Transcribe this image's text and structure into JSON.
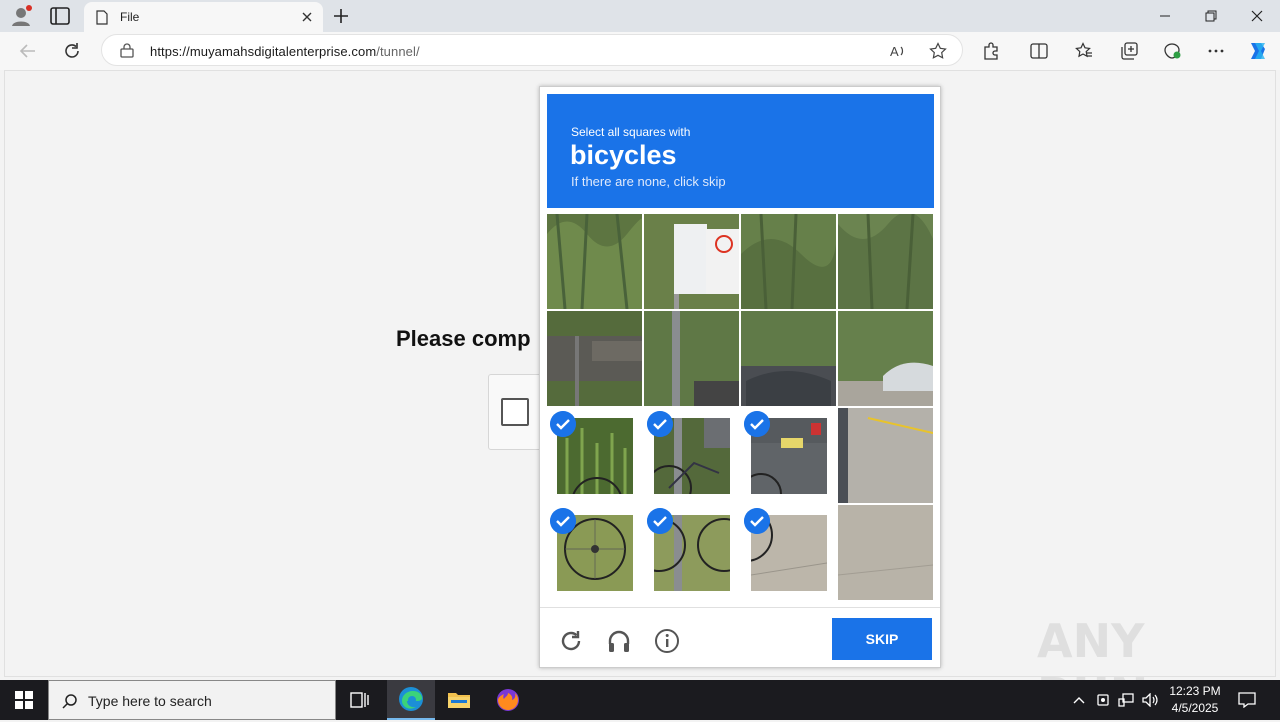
{
  "browser": {
    "tab_title": "File",
    "url_host": "https://muyamahsdigitalenterprise.com",
    "url_path": "/tunnel/"
  },
  "page": {
    "heading": "Please comp"
  },
  "captcha": {
    "instruction": "Select all squares with",
    "target": "bicycles",
    "hint": "If there are none, click skip",
    "skip_label": "SKIP",
    "tiles": [
      {
        "selected": false
      },
      {
        "selected": false
      },
      {
        "selected": false
      },
      {
        "selected": false
      },
      {
        "selected": false
      },
      {
        "selected": false
      },
      {
        "selected": false
      },
      {
        "selected": false
      },
      {
        "selected": true
      },
      {
        "selected": true
      },
      {
        "selected": true
      },
      {
        "selected": false
      },
      {
        "selected": true
      },
      {
        "selected": true
      },
      {
        "selected": true
      },
      {
        "selected": false
      }
    ]
  },
  "watermark": {
    "text": "ANY RUN"
  },
  "taskbar": {
    "search_placeholder": "Type here to search",
    "time": "12:23 PM",
    "date": "4/5/2025"
  },
  "colors": {
    "accent": "#1a73e8"
  }
}
